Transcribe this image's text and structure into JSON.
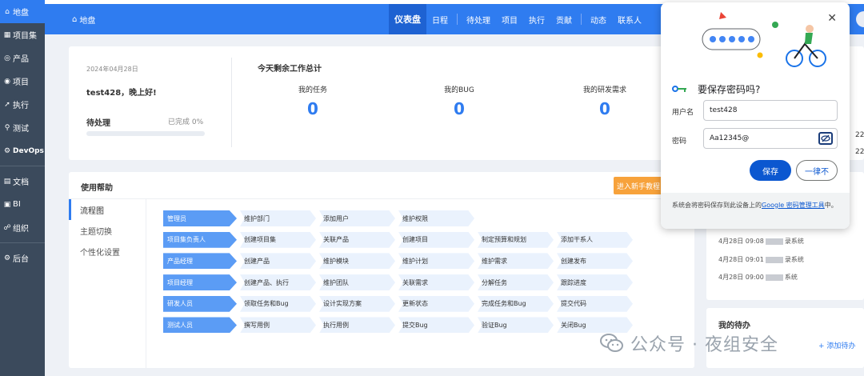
{
  "sidebar": {
    "items": [
      {
        "label": "地盘",
        "icon": "home-icon",
        "active": true
      },
      {
        "label": "项目集",
        "icon": "grid-icon"
      },
      {
        "label": "产品",
        "icon": "compass-icon"
      },
      {
        "label": "项目",
        "icon": "target-icon"
      },
      {
        "label": "执行",
        "icon": "rocket-icon"
      },
      {
        "label": "测试",
        "icon": "search-icon"
      },
      {
        "label": "DevOps",
        "icon": "gear-icon"
      },
      {
        "label": "文档",
        "icon": "document-icon"
      },
      {
        "label": "BI",
        "icon": "chart-icon"
      },
      {
        "label": "组织",
        "icon": "team-icon"
      },
      {
        "label": "后台",
        "icon": "admin-icon"
      }
    ]
  },
  "topbar": {
    "home_label": "地盘",
    "nav": [
      "仪表盘",
      "日程",
      "待处理",
      "项目",
      "执行",
      "贡献",
      "动态",
      "联系人"
    ]
  },
  "welcome": {
    "date": "2024年04月28日",
    "greeting": "test428，晚上好!",
    "todo_label": "待处理",
    "done_label": "已完成 0%",
    "progress": 0,
    "summary_title": "今天剩余工作总计",
    "stats": [
      {
        "label": "我的任务",
        "value": "0"
      },
      {
        "label": "我的BUG",
        "value": "0"
      },
      {
        "label": "我的研发需求",
        "value": "0"
      }
    ]
  },
  "help": {
    "title": "使用帮助",
    "guide_button": "进入新手教程",
    "tabs": [
      "流程图",
      "主题切换",
      "个性化设置"
    ],
    "flow": [
      {
        "role": "管理员",
        "steps": [
          "维护部门",
          "添加用户",
          "维护权限"
        ]
      },
      {
        "role": "项目集负责人",
        "steps": [
          "创建项目集",
          "关联产品",
          "创建项目",
          "制定预算和规划",
          "添加干系人"
        ]
      },
      {
        "role": "产品经理",
        "steps": [
          "创建产品",
          "维护模块",
          "维护计划",
          "维护需求",
          "创建发布"
        ]
      },
      {
        "role": "项目经理",
        "steps": [
          "创建产品、执行",
          "维护团队",
          "关联需求",
          "分解任务",
          "跟踪进度"
        ]
      },
      {
        "role": "研发人员",
        "steps": [
          "领取任务和Bug",
          "设计实现方案",
          "更新状态",
          "完成任务和Bug",
          "提交代码"
        ]
      },
      {
        "role": "测试人员",
        "steps": [
          "撰写用例",
          "执行用例",
          "提交Bug",
          "验证Bug",
          "关闭Bug"
        ]
      }
    ]
  },
  "dynamics": [
    {
      "time": "4月28日 09:08",
      "suffix": "录系统"
    },
    {
      "time": "4月28日 09:01",
      "suffix": "录系统"
    },
    {
      "time": "4月28日 09:00",
      "suffix": "系统"
    }
  ],
  "side_numbers": [
    "22",
    "22"
  ],
  "my_todo": {
    "title": "我的待办",
    "add_label": "添加待办"
  },
  "password_popup": {
    "title": "要保存密码吗?",
    "username_label": "用户名",
    "username_value": "test428",
    "password_label": "密码",
    "password_value": "Aa12345@",
    "save_label": "保存",
    "never_label": "一律不",
    "footer_text": "系统会将密码保存到此设备上的",
    "footer_link": "Google 密码管理工具",
    "footer_end": "中。"
  },
  "watermark": "公众号 · 夜组安全",
  "colors": {
    "accent": "#2f7cf0",
    "sidebar": "#3b4a5c",
    "guide": "#f7a23b",
    "google_blue": "#0b57d0"
  }
}
